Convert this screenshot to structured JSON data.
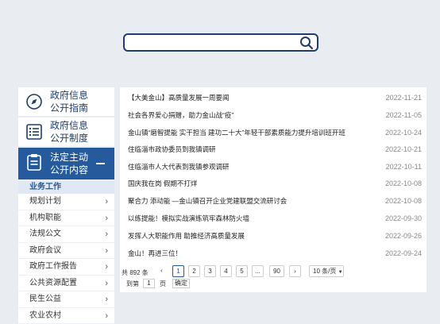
{
  "sidebar": {
    "nav": [
      {
        "line1": "政府信息",
        "line2": "公开指南"
      },
      {
        "line1": "政府信息",
        "line2": "公开制度"
      },
      {
        "line1": "法定主动",
        "line2": "公开内容"
      }
    ],
    "sub_header": "业务工作",
    "sub_items": [
      "规划计划",
      "机构职能",
      "法规公文",
      "政府会议",
      "政府工作报告",
      "公共资源配置",
      "民生公益",
      "农业农村"
    ]
  },
  "news": [
    {
      "title": "【大美金山】高质量发展一周要闻",
      "date": "2022-11-21"
    },
    {
      "title": "社会各界爱心捐赠，助力金山战“疫”",
      "date": "2022-11-05"
    },
    {
      "title": "金山镇“磨智提能 实干担当 建功二十大”年轻干部素质能力提升培训班开班",
      "date": "2022-10-24"
    },
    {
      "title": "住临淄市政协委员到我镇调研",
      "date": "2022-10-21"
    },
    {
      "title": "住临淄市人大代表到我镇参观调研",
      "date": "2022-10-11"
    },
    {
      "title": "国庆我在岗 假期不打烊",
      "date": "2022-10-08"
    },
    {
      "title": "聚合力 添动能 —金山镇召开企业党建联盟交流研讨会",
      "date": "2022-10-08"
    },
    {
      "title": "以练提能！模拟实战演练筑牢森林防火墙",
      "date": "2022-09-30"
    },
    {
      "title": "发挥人大职能作用 助推经济高质量发展",
      "date": "2022-09-26"
    },
    {
      "title": "金山！再进三位！",
      "date": "2022-09-24"
    }
  ],
  "pagination": {
    "total": "共 892 条",
    "prev": "‹",
    "pages": [
      "1",
      "2",
      "3",
      "4",
      "5",
      "...",
      "90"
    ],
    "next": "›",
    "page_size": "10 条/页",
    "goto_label": "到第",
    "goto_value": "1",
    "goto_unit": "页",
    "confirm": "确定"
  }
}
